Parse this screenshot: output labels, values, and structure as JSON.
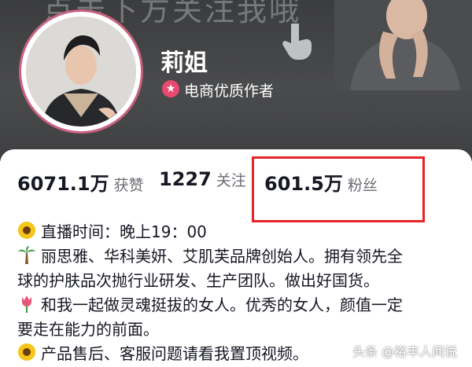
{
  "banner": {
    "text": "点击下方关注我哦",
    "background_color": "#3e3f41"
  },
  "profile": {
    "name": "莉姐",
    "certification": "电商优质作者",
    "certification_badge_color": "#e84a6f",
    "avatar_ring_color": "#c9617f"
  },
  "stats": [
    {
      "value": "6071.1万",
      "label": "获赞"
    },
    {
      "value": "1227",
      "label": "关注"
    },
    {
      "value": "601.5万",
      "label": "粉丝"
    }
  ],
  "highlight_color": "#e6242a",
  "bio": [
    {
      "icon": "sunflower-icon",
      "text": "直播时间：晚上19：00"
    },
    {
      "icon": "palm-tree-icon",
      "text": "丽思雅、华科美妍、艾肌芙品牌创始人。拥有领先全"
    },
    {
      "icon": "",
      "text": "球的护肤品次抛行业研发、生产团队。做出好国货。"
    },
    {
      "icon": "tulip-icon",
      "text": "和我一起做灵魂挺拔的女人。优秀的女人，颜值一定"
    },
    {
      "icon": "",
      "text": "要走在能力的前面。"
    },
    {
      "icon": "sunflower-icon",
      "text": "产品售后、客服问题请看我置顶视频。"
    }
  ],
  "watermark": "头条 @裕丰人间说"
}
